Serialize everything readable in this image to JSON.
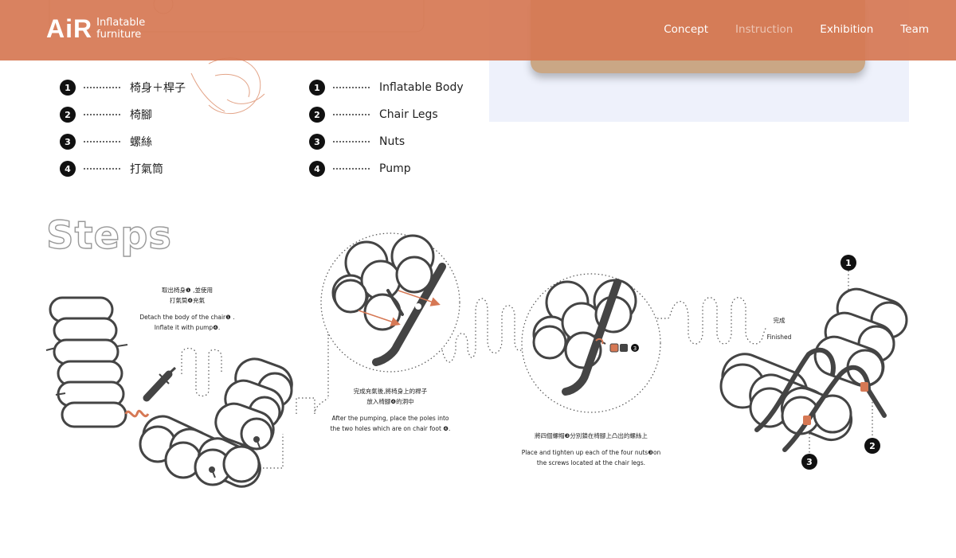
{
  "header": {
    "logo_mark": "AiR",
    "logo_line1": "Inflatable",
    "logo_line2": "furniture",
    "nav": [
      {
        "label": "Concept",
        "active": false
      },
      {
        "label": "Instruction",
        "active": true
      },
      {
        "label": "Exhibition",
        "active": false
      },
      {
        "label": "Team",
        "active": false
      }
    ]
  },
  "parts_zh": [
    {
      "num": "1",
      "label": "椅身＋桿子"
    },
    {
      "num": "2",
      "label": "椅腳"
    },
    {
      "num": "3",
      "label": "螺絲"
    },
    {
      "num": "4",
      "label": "打氣筒"
    }
  ],
  "parts_en": [
    {
      "num": "1",
      "label": "Inflatable Body"
    },
    {
      "num": "2",
      "label": "Chair Legs"
    },
    {
      "num": "3",
      "label": "Nuts"
    },
    {
      "num": "4",
      "label": "Pump"
    }
  ],
  "steps": {
    "title": "Steps",
    "step1": {
      "zh_line1": "取出椅身❶ ,並使用",
      "zh_line2": "打氣筒❹充氣",
      "en_line1": "Detach the body of the chair❶ .",
      "en_line2": "Inflate it with  pump❹."
    },
    "step2": {
      "zh_line1": "完成充氣後,將椅身上的桿子",
      "zh_line2": "放入椅腳❹的洞中",
      "en_line1": "After the pumping, place the poles into",
      "en_line2": "the two holes which are on chair foot ❹."
    },
    "step3": {
      "zh_line1": "將四個螺帽❸分別鎖在椅腳上凸出的螺絲上",
      "en_line1": "Place and tighten up each of the four nuts❸on",
      "en_line2": "the screws located at the chair legs.",
      "nut_label": "3"
    },
    "step4": {
      "zh_line1": "完成",
      "en_line1": "Finished",
      "callout1": "1",
      "callout2": "2",
      "callout3": "3"
    }
  },
  "colors": {
    "header_bg": "#d67854",
    "accent_orange": "#d67854",
    "stroke_dark": "#444444",
    "panel_bg": "#eef1fb"
  }
}
